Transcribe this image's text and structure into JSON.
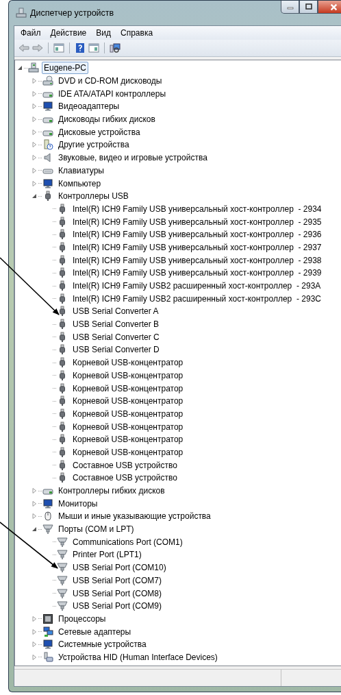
{
  "window": {
    "title": "Диспетчер устройств"
  },
  "menu": [
    {
      "label": "Файл"
    },
    {
      "label": "Действие"
    },
    {
      "label": "Вид"
    },
    {
      "label": "Справка"
    }
  ],
  "tree": {
    "label": "Eugene-PC",
    "kind": "computer",
    "expanded": true,
    "selected": true,
    "children": [
      {
        "label": "DVD и CD-ROM дисководы",
        "kind": "optical",
        "expanded": false,
        "selected": false
      },
      {
        "label": "IDE ATA/ATAPI контроллеры",
        "kind": "drive",
        "expanded": false,
        "selected": false
      },
      {
        "label": "Видеоадаптеры",
        "kind": "display",
        "expanded": false,
        "selected": false
      },
      {
        "label": "Дисководы гибких дисков",
        "kind": "drive",
        "expanded": false,
        "selected": false
      },
      {
        "label": "Дисковые устройства",
        "kind": "drive",
        "expanded": false,
        "selected": false
      },
      {
        "label": "Другие устройства",
        "kind": "unknown",
        "expanded": false,
        "selected": false
      },
      {
        "label": "Звуковые, видео и игровые устройства",
        "kind": "sound",
        "expanded": false,
        "selected": false
      },
      {
        "label": "Клавиатуры",
        "kind": "keyboard",
        "expanded": false,
        "selected": false
      },
      {
        "label": "Компьютер",
        "kind": "display",
        "expanded": false,
        "selected": false
      },
      {
        "label": "Контроллеры USB",
        "kind": "usb",
        "expanded": true,
        "selected": false,
        "children": [
          {
            "label": "Intel(R) ICH9 Family USB универсальный хост-контроллер  - 2934",
            "selected": false
          },
          {
            "label": "Intel(R) ICH9 Family USB универсальный хост-контроллер  - 2935",
            "selected": false
          },
          {
            "label": "Intel(R) ICH9 Family USB универсальный хост-контроллер  - 2936",
            "selected": false
          },
          {
            "label": "Intel(R) ICH9 Family USB универсальный хост-контроллер  - 2937",
            "selected": false
          },
          {
            "label": "Intel(R) ICH9 Family USB универсальный хост-контроллер  - 2938",
            "selected": false
          },
          {
            "label": "Intel(R) ICH9 Family USB универсальный хост-контроллер  - 2939",
            "selected": false
          },
          {
            "label": "Intel(R) ICH9 Family USB2 расширенный хост-контроллер  - 293A",
            "selected": false
          },
          {
            "label": "Intel(R) ICH9 Family USB2 расширенный хост-контроллер  - 293C",
            "selected": false
          },
          {
            "label": "USB Serial Converter A",
            "selected": false
          },
          {
            "label": "USB Serial Converter B",
            "selected": false
          },
          {
            "label": "USB Serial Converter C",
            "selected": false
          },
          {
            "label": "USB Serial Converter D",
            "selected": false
          },
          {
            "label": "Корневой USB-концентратор",
            "selected": false
          },
          {
            "label": "Корневой USB-концентратор",
            "selected": false
          },
          {
            "label": "Корневой USB-концентратор",
            "selected": false
          },
          {
            "label": "Корневой USB-концентратор",
            "selected": false
          },
          {
            "label": "Корневой USB-концентратор",
            "selected": false
          },
          {
            "label": "Корневой USB-концентратор",
            "selected": false
          },
          {
            "label": "Корневой USB-концентратор",
            "selected": false
          },
          {
            "label": "Корневой USB-концентратор",
            "selected": false
          },
          {
            "label": "Составное USB устройство",
            "selected": false
          },
          {
            "label": "Составное USB устройство",
            "selected": false
          }
        ]
      },
      {
        "label": "Контроллеры гибких дисков",
        "kind": "drive",
        "expanded": false,
        "selected": false
      },
      {
        "label": "Мониторы",
        "kind": "display",
        "expanded": false,
        "selected": false
      },
      {
        "label": "Мыши и иные указывающие устройства",
        "kind": "mouse",
        "expanded": false,
        "selected": false
      },
      {
        "label": "Порты (COM и LPT)",
        "kind": "port",
        "expanded": true,
        "selected": false,
        "children": [
          {
            "label": "Communications Port (COM1)",
            "selected": false
          },
          {
            "label": "Printer Port (LPT1)",
            "selected": false
          },
          {
            "label": "USB Serial Port (COM10)",
            "selected": false
          },
          {
            "label": "USB Serial Port (COM7)",
            "selected": false
          },
          {
            "label": "USB Serial Port (COM8)",
            "selected": false
          },
          {
            "label": "USB Serial Port (COM9)",
            "selected": false
          }
        ]
      },
      {
        "label": "Процессоры",
        "kind": "cpu",
        "expanded": false,
        "selected": false
      },
      {
        "label": "Сетевые адаптеры",
        "kind": "network",
        "expanded": false,
        "selected": false
      },
      {
        "label": "Системные устройства",
        "kind": "display",
        "expanded": false,
        "selected": false
      },
      {
        "label": "Устройства HID (Human Interface Devices)",
        "kind": "hid",
        "expanded": false,
        "selected": false
      }
    ]
  }
}
